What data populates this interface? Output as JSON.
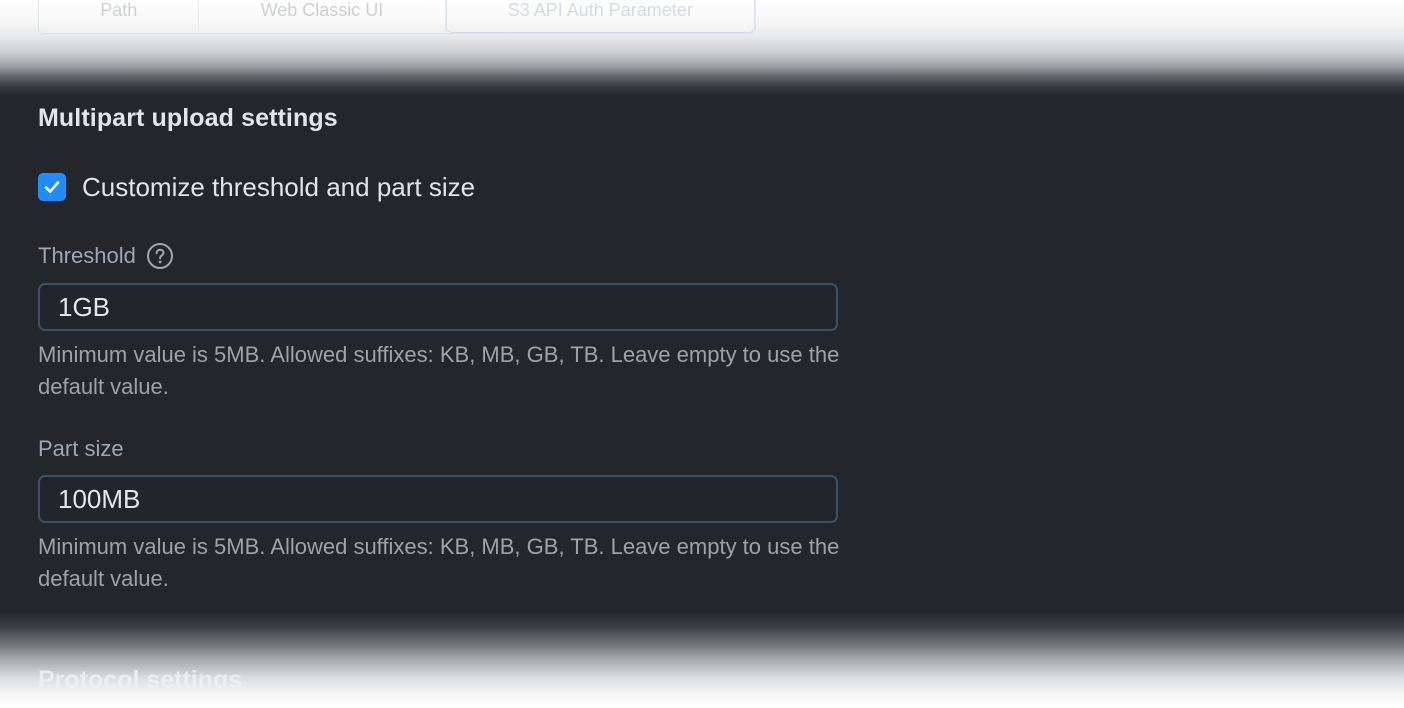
{
  "top_segmented_control": {
    "options": [
      "Path",
      "Web Classic UI",
      "S3 API Auth Parameter"
    ],
    "selected_index": 2
  },
  "multipart": {
    "title": "Multipart upload settings",
    "customize_checkbox": {
      "label": "Customize threshold and part size",
      "checked": true
    },
    "threshold": {
      "label": "Threshold",
      "help_icon": "question-circle-icon",
      "value": "1GB",
      "hint": "Minimum value is 5MB. Allowed suffixes: KB, MB, GB, TB. Leave empty to use the default value."
    },
    "part_size": {
      "label": "Part size",
      "value": "100MB",
      "hint": "Minimum value is 5MB. Allowed suffixes: KB, MB, GB, TB. Leave empty to use the default value."
    }
  },
  "next_section": {
    "title": "Protocol settings"
  },
  "colors": {
    "panel_bg": "#23262b",
    "accent": "#1f8cff",
    "input_border": "#3b5168"
  }
}
